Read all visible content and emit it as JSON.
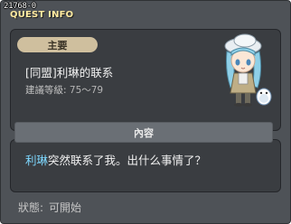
{
  "window": {
    "id_label": "21768-0",
    "title": "QUEST INFO"
  },
  "quest": {
    "category": "主要",
    "name": "[同盟]利琳的联系",
    "level_label": "建議等級:",
    "level_range": "75～79"
  },
  "content": {
    "header": "內容",
    "npc_name": "利琳",
    "message": "突然联系了我。出什么事情了？"
  },
  "status": {
    "label": "狀態:",
    "value": "可開始"
  },
  "colors": {
    "window_bg": "#4e5257",
    "panel_bg": "#3a3d41",
    "title": "#ffeaa0",
    "badge": "#cfbf9e",
    "npc_highlight": "#7ed8ff"
  },
  "icons": {
    "npc": "npc-portrait-lilin"
  }
}
